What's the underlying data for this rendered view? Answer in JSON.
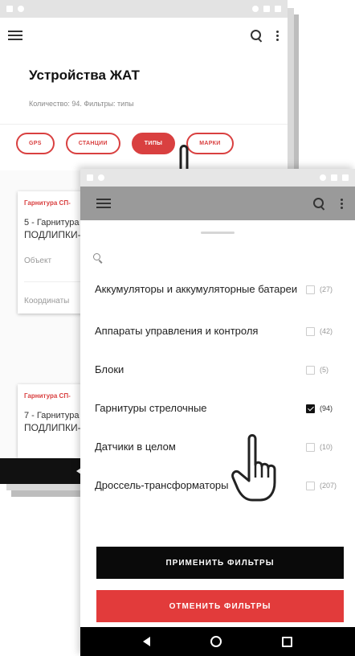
{
  "back_screen": {
    "title": "Устройства ЖАТ",
    "count_text": "Количество: 94. Фильтры: типы",
    "chips": [
      {
        "label": "GPS",
        "active": false
      },
      {
        "label": "СТАНЦИИ",
        "active": false
      },
      {
        "label": "ТИПЫ",
        "active": true
      },
      {
        "label": "МАРКИ",
        "active": false
      }
    ],
    "cards": [
      {
        "tag": "Гарнитура СП-",
        "name": "5 - Гарнитура",
        "place": "ПОДЛИПКИ-",
        "field": "Объект",
        "coords": "Координаты"
      },
      {
        "tag": "Гарнитура СП-",
        "name": "7 - Гарнитура",
        "place": "ПОДЛИПКИ-"
      }
    ]
  },
  "filter_sheet": {
    "rows": [
      {
        "label": "Аккумуляторы и аккумуляторные батареи",
        "count": "(27)",
        "checked": false
      },
      {
        "label": "Аппараты управления и контроля",
        "count": "(42)",
        "checked": false
      },
      {
        "label": "Блоки",
        "count": "(5)",
        "checked": false
      },
      {
        "label": "Гарнитуры стрелочные",
        "count": "(94)",
        "checked": true
      },
      {
        "label": "Датчики в целом",
        "count": "(10)",
        "checked": false
      },
      {
        "label": "Дроссель-трансформаторы",
        "count": "(207)",
        "checked": false
      }
    ],
    "apply_label": "ПРИМЕНИТЬ ФИЛЬТРЫ",
    "cancel_label": "ОТМЕНИТЬ ФИЛЬТРЫ"
  },
  "colors": {
    "accent": "#d94040",
    "apply": "#0a0a0a",
    "cancel": "#e23b3b"
  },
  "icons": [
    "menu-icon",
    "search-icon",
    "more-vert-icon",
    "back-nav-icon",
    "home-nav-icon",
    "recents-nav-icon",
    "hand-pointer-icon"
  ]
}
